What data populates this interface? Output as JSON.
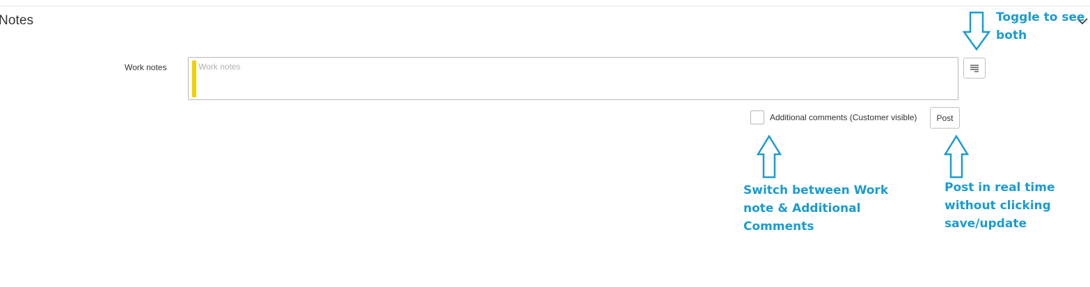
{
  "section": {
    "title": "Notes"
  },
  "work_notes": {
    "label": "Work notes",
    "placeholder": "Work notes",
    "value": ""
  },
  "additional_comments": {
    "label": "Additional comments (Customer visible)",
    "checked": false
  },
  "post_button": {
    "label": "Post"
  },
  "icons": {
    "collapse": "chevron-down-icon",
    "toggle": "stacked-lines-icon"
  },
  "annotations": {
    "toggle": [
      "Toggle to see",
      "both"
    ],
    "switch": [
      "Switch between Work",
      "note & Additional",
      "Comments"
    ],
    "post": [
      "Post in real time",
      "without clicking",
      "save/update"
    ]
  },
  "colors": {
    "annotation": "#1b9bd0",
    "mandatory": "#f2d000"
  }
}
